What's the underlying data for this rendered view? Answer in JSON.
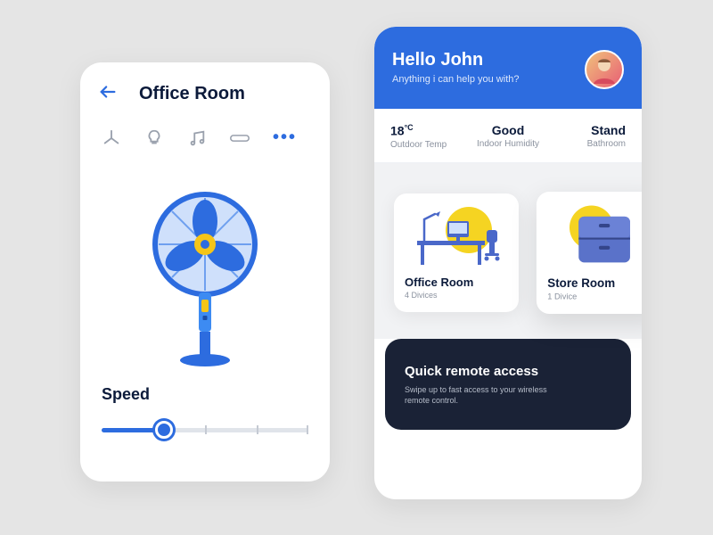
{
  "left": {
    "title": "Office Room",
    "speed_label": "Speed"
  },
  "right": {
    "greeting": "Hello John",
    "subtitle": "Anything i can help you with?",
    "stats": {
      "temp_value": "18",
      "temp_unit": "°C",
      "temp_label": "Outdoor Temp",
      "humidity_value": "Good",
      "humidity_label": "Indoor Humidity",
      "third_value": "Stand",
      "third_label": "Bathroom"
    },
    "rooms": [
      {
        "title": "Office Room",
        "sub": "4 Divices"
      },
      {
        "title": "Store Room",
        "sub": "1 Divice"
      }
    ],
    "quick": {
      "title": "Quick remote access",
      "sub": "Swipe up to fast access to your wireless remote control."
    }
  }
}
